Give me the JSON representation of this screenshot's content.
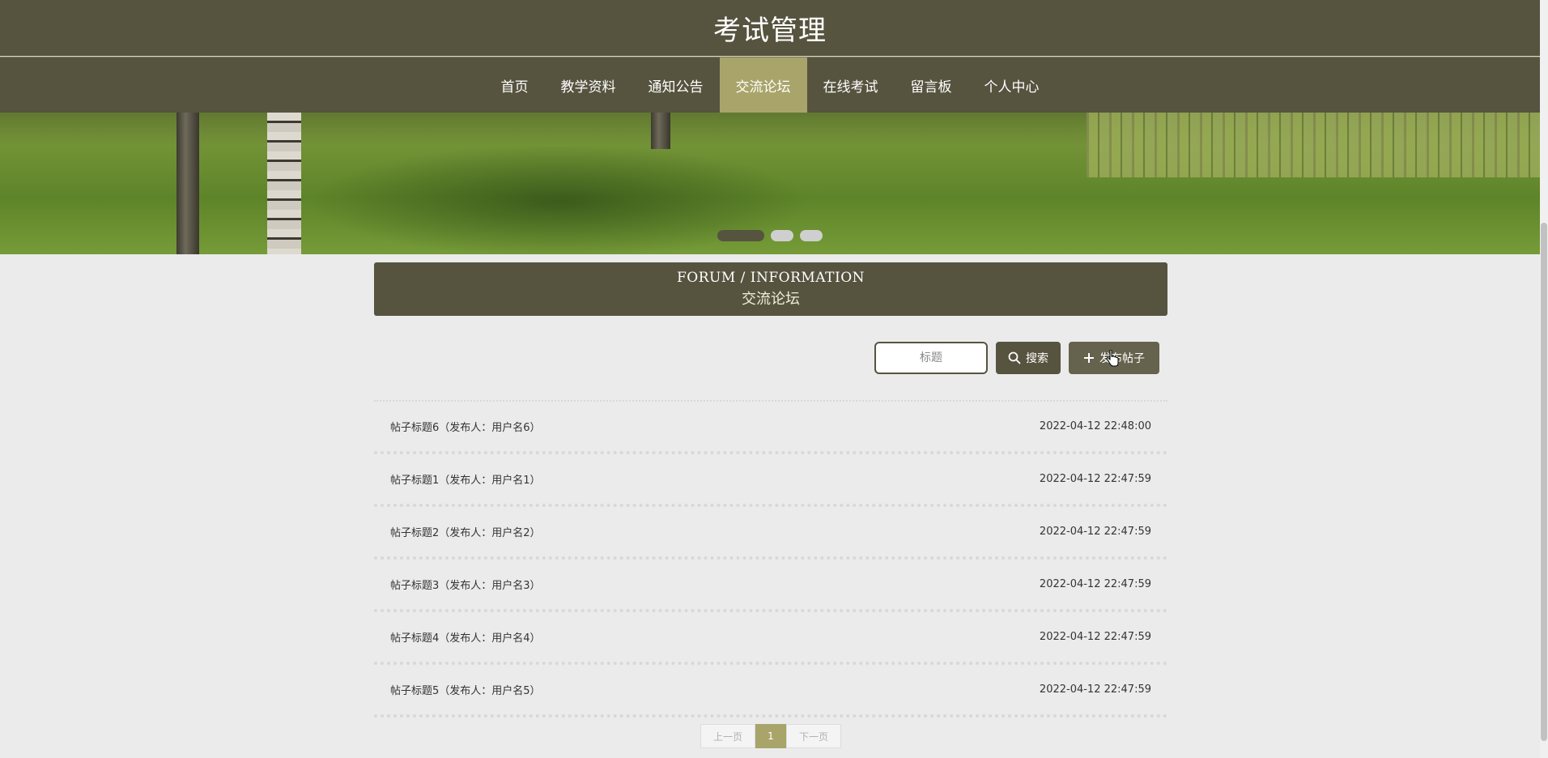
{
  "header": {
    "title": "考试管理"
  },
  "nav": {
    "items": [
      {
        "label": "首页",
        "active": false
      },
      {
        "label": "教学资料",
        "active": false
      },
      {
        "label": "通知公告",
        "active": false
      },
      {
        "label": "交流论坛",
        "active": true
      },
      {
        "label": "在线考试",
        "active": false
      },
      {
        "label": "留言板",
        "active": false
      },
      {
        "label": "个人中心",
        "active": false
      }
    ]
  },
  "banner": {
    "slides": 3,
    "active_slide": 1
  },
  "section": {
    "en_title": "FORUM / INFORMATION",
    "cn_title": "交流论坛"
  },
  "toolbar": {
    "search_placeholder": "标题",
    "search_label": "搜索",
    "add_label": "发布帖子"
  },
  "posts": [
    {
      "title": "帖子标题6（发布人：用户名6）",
      "date": "2022-04-12 22:48:00"
    },
    {
      "title": "帖子标题1（发布人：用户名1）",
      "date": "2022-04-12 22:47:59"
    },
    {
      "title": "帖子标题2（发布人：用户名2）",
      "date": "2022-04-12 22:47:59"
    },
    {
      "title": "帖子标题3（发布人：用户名3）",
      "date": "2022-04-12 22:47:59"
    },
    {
      "title": "帖子标题4（发布人：用户名4）",
      "date": "2022-04-12 22:47:59"
    },
    {
      "title": "帖子标题5（发布人：用户名5）",
      "date": "2022-04-12 22:47:59"
    }
  ],
  "pagination": {
    "prev_label": "上一页",
    "current": "1",
    "next_label": "下一页"
  },
  "colors": {
    "primary": "#56533f",
    "accent": "#a9a46a",
    "background": "#ebebeb"
  }
}
